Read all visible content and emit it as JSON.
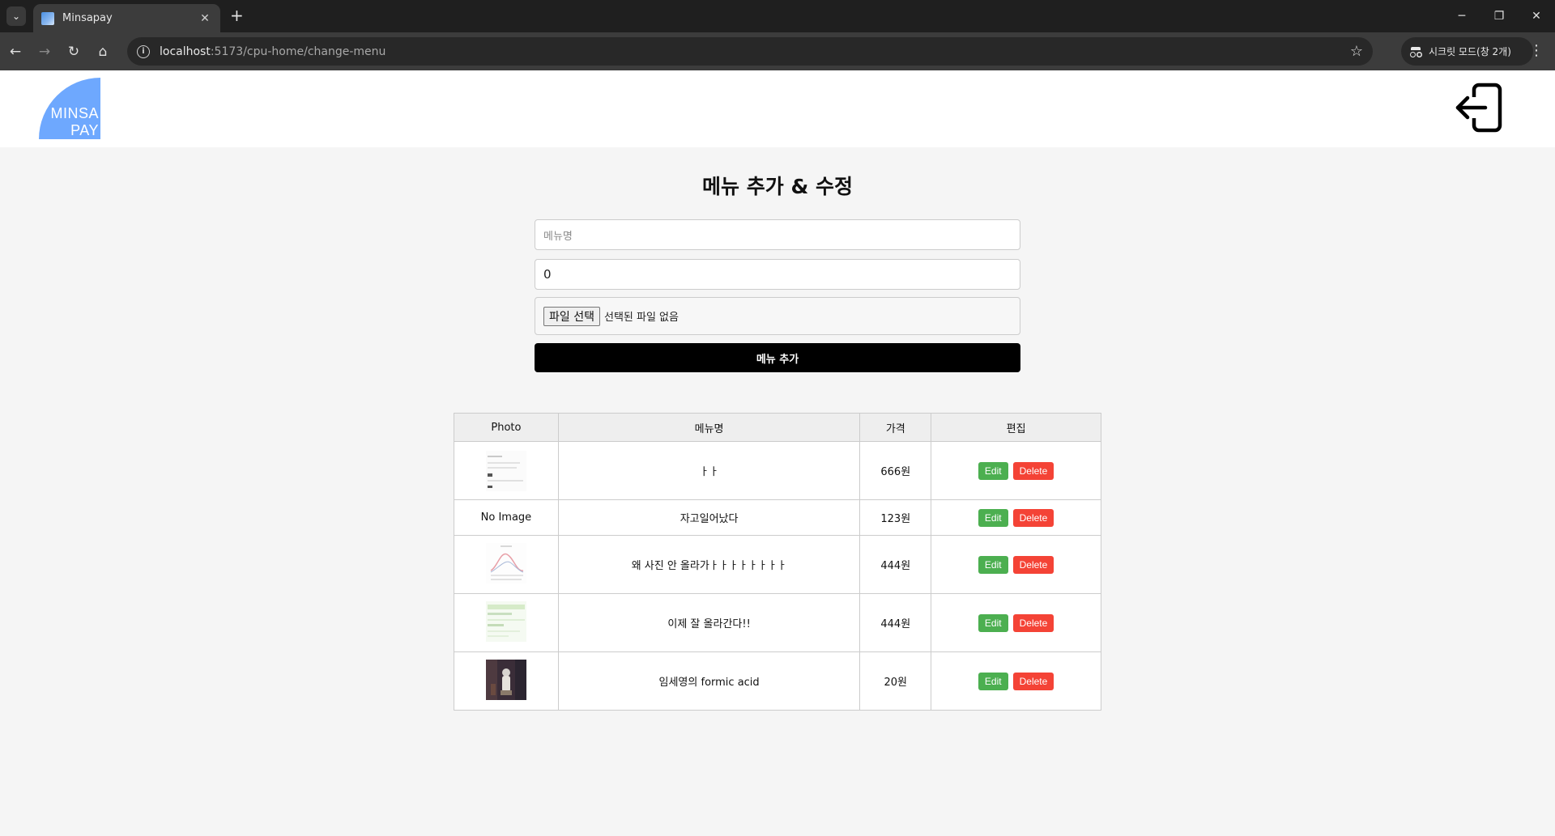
{
  "browser": {
    "tab_title": "Minsapay",
    "url_host": "localhost",
    "url_path": ":5173/cpu-home/change-menu",
    "incognito_label": "시크릿 모드(창 2개)"
  },
  "header": {
    "logo_line1": "MINSA",
    "logo_line2": "PAY"
  },
  "form": {
    "title": "메뉴 추가 & 수정",
    "name_placeholder": "메뉴명",
    "price_value": "0",
    "file_button": "파일 선택",
    "file_status": "선택된 파일 없음",
    "submit_label": "메뉴 추가"
  },
  "table": {
    "headers": [
      "Photo",
      "메뉴명",
      "가격",
      "편집"
    ],
    "edit_label": "Edit",
    "delete_label": "Delete",
    "no_image": "No Image",
    "rows": [
      {
        "name": "ㅏㅏ",
        "price": "666원",
        "photo": "document-thumbnail"
      },
      {
        "name": "자고일어났다",
        "price": "123원",
        "photo": null
      },
      {
        "name": "왜 사진 안 올라가ㅏㅏㅏㅏㅏㅏㅏㅏ",
        "price": "444원",
        "photo": "chart-thumbnail"
      },
      {
        "name": "이제 잘 올라간다!!",
        "price": "444원",
        "photo": "green-document-thumbnail"
      },
      {
        "name": "임세영의 formic acid",
        "price": "20원",
        "photo": "photo-thumbnail"
      }
    ]
  }
}
